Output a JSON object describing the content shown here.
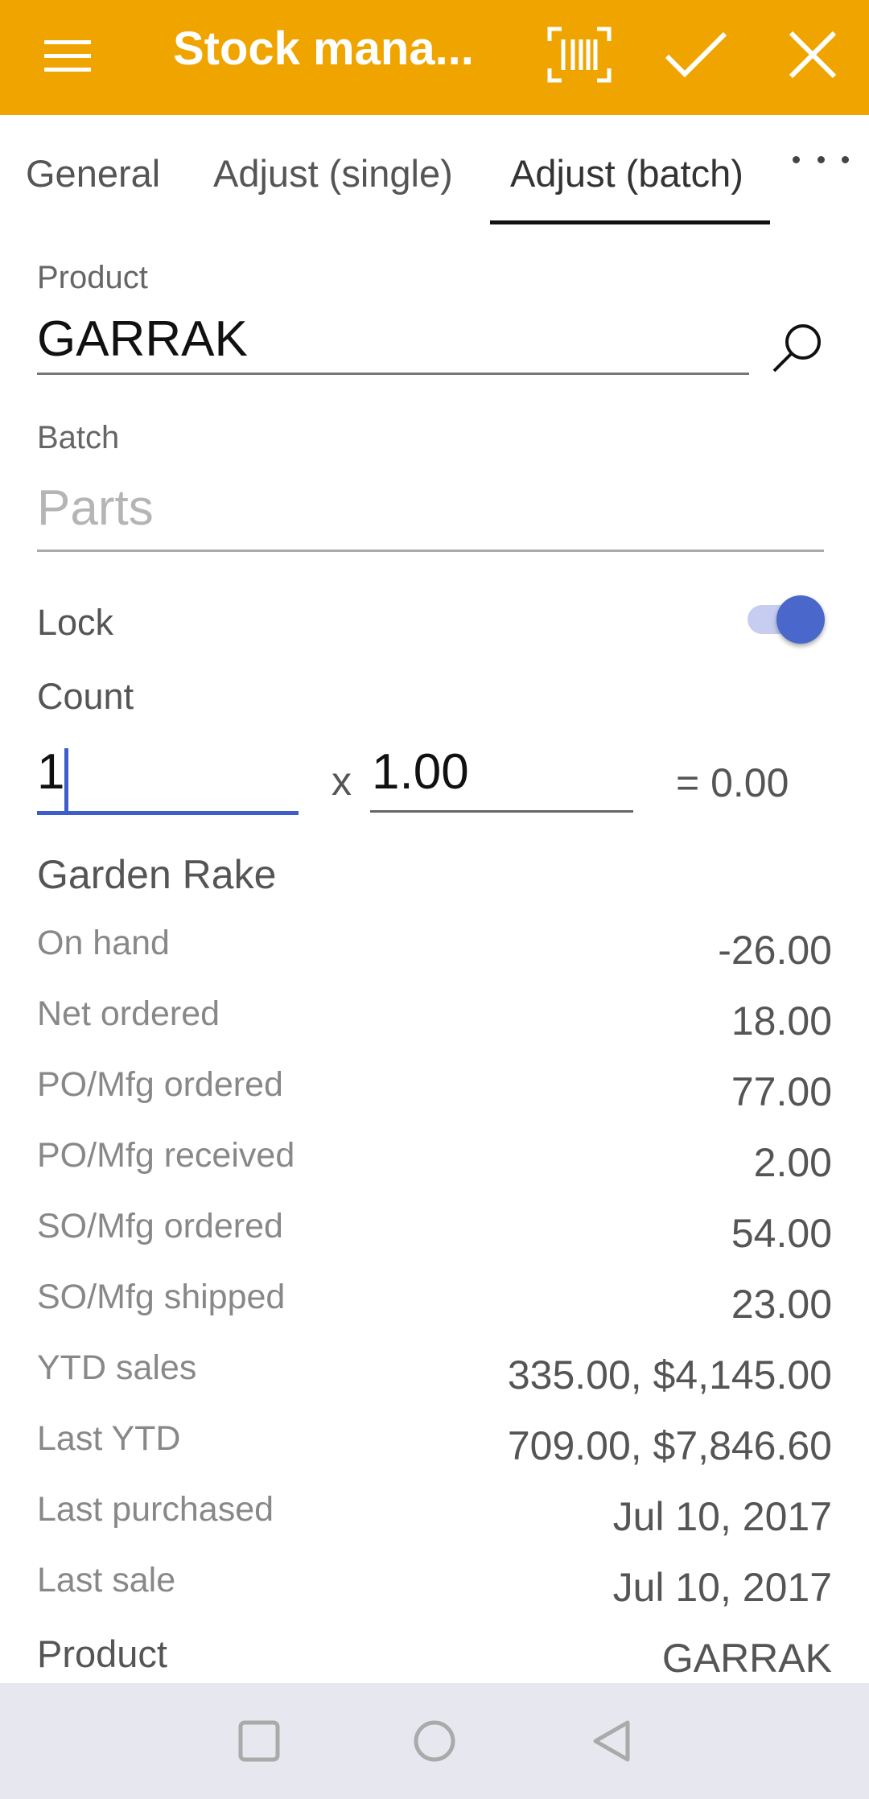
{
  "appbar": {
    "title": "Stock mana...",
    "icons": [
      "menu-icon",
      "barcode-scan-icon",
      "check-icon",
      "close-icon"
    ],
    "color": "#EFA400"
  },
  "tabs": [
    {
      "label": "General"
    },
    {
      "label": "Adjust (single)"
    },
    {
      "label": "Adjust (batch)",
      "active": true
    }
  ],
  "form": {
    "product_label": "Product",
    "product_value": "GARRAK",
    "batch_label": "Batch",
    "batch_placeholder": "Parts",
    "lock_label": "Lock",
    "lock_on": true,
    "count_label": "Count",
    "count_value": "1",
    "multiply_symbol": "x",
    "factor_value": "1.00",
    "result_text": "= 0.00"
  },
  "details": {
    "title": "Garden Rake",
    "rows": [
      {
        "label": "On hand",
        "value": "-26.00"
      },
      {
        "label": "Net ordered",
        "value": "18.00"
      },
      {
        "label": "PO/Mfg ordered",
        "value": "77.00"
      },
      {
        "label": "PO/Mfg received",
        "value": "2.00"
      },
      {
        "label": "SO/Mfg ordered",
        "value": "54.00"
      },
      {
        "label": "SO/Mfg shipped",
        "value": "23.00"
      },
      {
        "label": "YTD sales",
        "value": "335.00, $4,145.00"
      },
      {
        "label": "Last YTD",
        "value": "709.00, $7,846.60"
      },
      {
        "label": "Last purchased",
        "value": "Jul 10, 2017"
      },
      {
        "label": "Last sale",
        "value": "Jul 10, 2017"
      },
      {
        "label": "Product",
        "value": "GARRAK"
      }
    ]
  },
  "navbar": {
    "icons": [
      "recents-square-icon",
      "home-circle-icon",
      "back-triangle-icon"
    ]
  }
}
